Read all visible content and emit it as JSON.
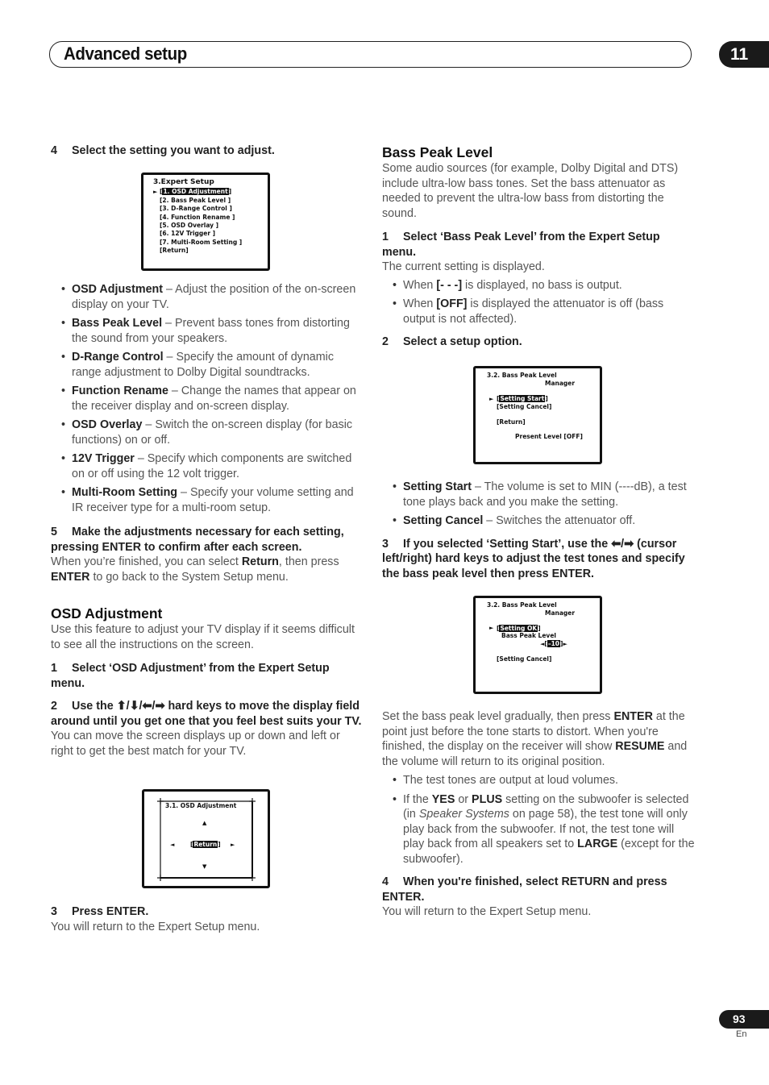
{
  "header": {
    "title": "Advanced setup",
    "chapter": "11"
  },
  "footer": {
    "page_number": "93",
    "language": "En"
  },
  "left": {
    "step4": {
      "num": "4",
      "text": "Select the setting you want to adjust."
    },
    "expert_menu": {
      "title": "3.Expert Setup",
      "items": [
        "[1. OSD Adjustment ]",
        "[2. Bass Peak Level ]",
        "[3. D-Range Control ]",
        "[4. Function Rename ]",
        "[5. OSD Overlay ]",
        "[6. 12V Trigger ]",
        "[7. Multi-Room Setting ]",
        "[Return]"
      ],
      "selected_label": "1. OSD Adjustment",
      "pointer": "►"
    },
    "bullets": [
      {
        "term": "OSD Adjustment",
        "desc": " – Adjust the position of the on-screen display on your TV."
      },
      {
        "term": "Bass Peak Level",
        "desc": " – Prevent bass tones from distorting the sound from your speakers."
      },
      {
        "term": "D-Range Control",
        "desc": " – Specify the amount of dynamic range adjustment to Dolby Digital soundtracks."
      },
      {
        "term": "Function Rename",
        "desc": " – Change the names that appear on the receiver display and on-screen display."
      },
      {
        "term": "OSD Overlay",
        "desc": " – Switch the on-screen display (for basic functions) on or off."
      },
      {
        "term": "12V Trigger",
        "desc": " – Specify which components are switched on or off using the 12 volt trigger."
      },
      {
        "term": "Multi-Room Setting",
        "desc": " – Specify your volume setting and IR receiver type for a multi-room setup."
      }
    ],
    "step5": {
      "num": "5",
      "text": "Make the adjustments necessary for each setting, pressing ENTER to confirm after each screen.",
      "body_a": "When you’re finished, you can select ",
      "body_b": "Return",
      "body_c": ", then press ",
      "body_d": "ENTER",
      "body_e": " to go back to the System Setup menu."
    },
    "osd_section": {
      "title": "OSD Adjustment",
      "intro": "Use this feature to adjust your TV display if it seems difficult to see all the instructions on the screen.",
      "step1": {
        "num": "1",
        "text": "Select ‘OSD Adjustment’ from the Expert Setup menu."
      },
      "step2": {
        "num": "2",
        "text_a": "Use the ",
        "keys": "⬆/⬇/⬅/➡",
        "text_b": " hard keys to move the display field around until you get one that you feel best suits your TV.",
        "body": "You can move the screen displays up or down and left or right to get the best match for your TV."
      },
      "screen": {
        "title": "3.1. OSD  Adjustment",
        "button": "Return",
        "up": "▲",
        "down": "▼",
        "left": "◄",
        "right": "►"
      },
      "step3": {
        "num": "3",
        "text": "Press ENTER.",
        "body": "You will return to the Expert Setup menu."
      }
    }
  },
  "right": {
    "bass_section": {
      "title": "Bass Peak Level",
      "intro": "Some audio sources (for example, Dolby Digital and DTS) include ultra-low bass tones. Set the bass attenuator as needed to prevent the ultra-low bass from distorting the sound.",
      "step1": {
        "num": "1",
        "text": "Select ‘Bass Peak Level’ from the Expert Setup menu.",
        "body": "The current setting is displayed."
      },
      "step1_bullets": [
        {
          "pre": "When ",
          "term": "[- - -]",
          "desc": " is displayed, no bass is output."
        },
        {
          "pre": "When ",
          "term": "[OFF]",
          "desc": " is displayed the attenuator is off (bass output is not affected)."
        }
      ],
      "step2": {
        "num": "2",
        "text": "Select a setup option."
      },
      "screen1": {
        "title_line1": "3.2. Bass  Peak  Level",
        "title_line2": "Manager",
        "pointer": "►",
        "selected": "Setting  Start",
        "item2": "[Setting  Cancel]",
        "item3": "[Return]",
        "present": "Present Level [OFF]"
      },
      "step2_bullets": [
        {
          "term": "Setting Start",
          "desc": " – The volume is set to MIN (----dB), a test tone plays back and you make the setting."
        },
        {
          "term": "Setting Cancel",
          "desc": " – Switches the attenuator off."
        }
      ],
      "step3": {
        "num": "3",
        "text_a": "If you selected ‘Setting Start’, use the ",
        "keys": "⬅/➡",
        "text_b": " (cursor left/right) hard keys to adjust the test tones and specify the bass peak level then press ENTER."
      },
      "screen2": {
        "title_line1": "3.2. Bass  Peak  Level",
        "title_line2": "Manager",
        "pointer": "►",
        "selected": "Setting  OK",
        "label": "Bass  Peak  Level",
        "value": "–10",
        "left_arrow": "◄",
        "right_arrow": "►",
        "cancel": "[Setting  Cancel]"
      },
      "after_screen": {
        "a": "Set the bass peak level gradually, then press ",
        "b": "ENTER",
        "c": " at the point just before the tone starts to distort. When you're finished, the display on the receiver will show ",
        "d": "RESUME",
        "e": " and the volume will return to its original position."
      },
      "notes": {
        "n1": "The test tones are output at loud volumes.",
        "n2_a": "If the ",
        "n2_b": "YES",
        "n2_c": " or ",
        "n2_d": "PLUS",
        "n2_e": " setting on the subwoofer is selected (in ",
        "n2_f": "Speaker Systems",
        "n2_g": " on page 58), the test tone will only play back from the subwoofer. If not, the test tone will play back from all speakers set to ",
        "n2_h": "LARGE",
        "n2_i": " (except for the subwoofer)."
      },
      "step4": {
        "num": "4",
        "text": "When you're finished, select RETURN and press ENTER.",
        "body": "You will return to the Expert Setup menu."
      }
    }
  }
}
